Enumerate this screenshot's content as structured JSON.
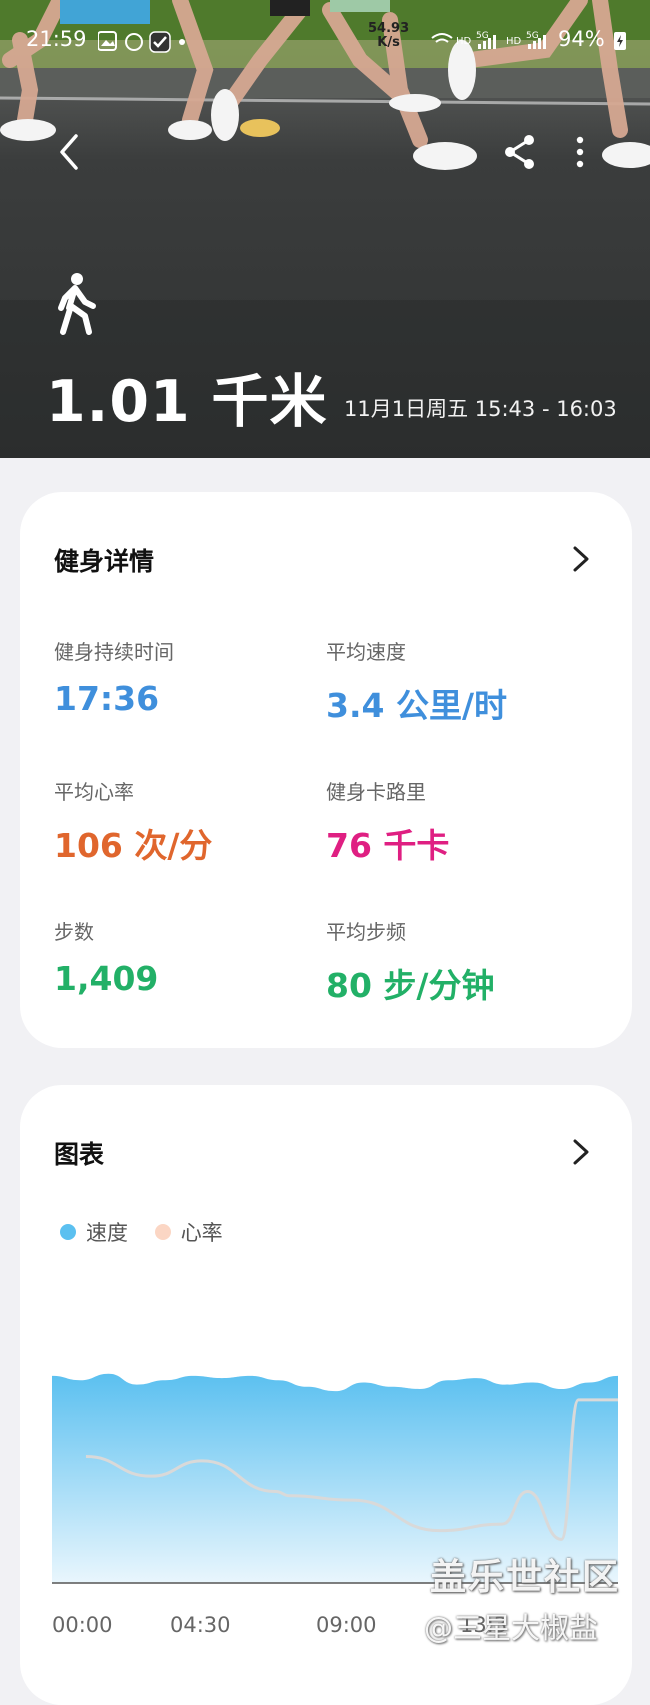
{
  "status_bar": {
    "time": "21:59",
    "net_speed_value": "54.93",
    "net_speed_unit": "K/s",
    "network_labels": [
      "HD",
      "5G",
      "HD",
      "5G"
    ],
    "battery": "94%"
  },
  "hero": {
    "activity_icon": "walking-person-icon",
    "distance": "1.01 千米",
    "time_range": "11月1日周五 15:43 - 16:03"
  },
  "details_card": {
    "title": "健身详情",
    "stats": [
      {
        "label": "健身持续时间",
        "value": "17:36",
        "color": "#3f8fdc"
      },
      {
        "label": "平均速度",
        "value": "3.4 公里/时",
        "color": "#3f8fdc"
      },
      {
        "label": "平均心率",
        "value": "106 次/分",
        "color": "#e0662d"
      },
      {
        "label": "健身卡路里",
        "value": "76 千卡",
        "color": "#df1f82"
      },
      {
        "label": "步数",
        "value": "1,409",
        "color": "#22b067"
      },
      {
        "label": "平均步频",
        "value": "80 步/分钟",
        "color": "#22b067"
      }
    ]
  },
  "chart_card": {
    "title": "图表",
    "legend": [
      {
        "name": "速度",
        "color": "#5bc0f0"
      },
      {
        "name": "心率",
        "color": "#fbd6c4"
      }
    ],
    "x_ticks": [
      "00:00",
      "04:30",
      "09:00",
      "13:3"
    ]
  },
  "chart_data": {
    "type": "area",
    "xlabel": "",
    "ylabel": "",
    "x_ticks": [
      "00:00",
      "04:30",
      "09:00",
      "13:3"
    ],
    "series": [
      {
        "name": "速度",
        "type": "area",
        "color": "#5bc0f0",
        "x": [
          0,
          1,
          2,
          3,
          4,
          5,
          6,
          7,
          8,
          9,
          10,
          11,
          12,
          13,
          14,
          15,
          16,
          17,
          18,
          19,
          20
        ],
        "values": [
          0.95,
          0.93,
          0.96,
          0.91,
          0.93,
          0.95,
          0.94,
          0.95,
          0.93,
          0.9,
          0.88,
          0.92,
          0.9,
          0.89,
          0.93,
          0.94,
          0.91,
          0.92,
          0.89,
          0.92,
          0.95
        ]
      },
      {
        "name": "心率",
        "type": "line",
        "color": "#d9d9d9",
        "x": [
          1.2,
          3.5,
          5.3,
          7.9,
          8.4,
          10.6,
          13.7,
          15.9,
          16.8,
          18.0,
          18.6,
          19.6,
          20.0
        ],
        "values": [
          0.58,
          0.49,
          0.56,
          0.42,
          0.4,
          0.38,
          0.24,
          0.27,
          0.42,
          0.2,
          0.84,
          0.84,
          0.84
        ]
      }
    ]
  },
  "watermark": {
    "line1": "盖乐世社区",
    "line2": "@三星大椒盐"
  }
}
